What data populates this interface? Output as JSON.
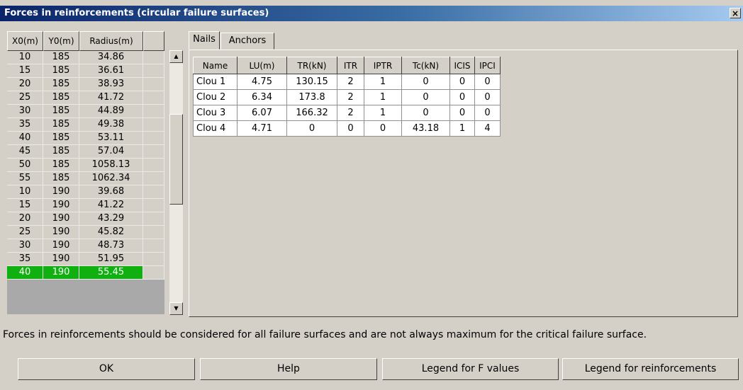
{
  "window": {
    "title": "Forces in reinforcements (circular failure surfaces)",
    "close_label": "×"
  },
  "surfaces": {
    "columns": [
      "X0(m)",
      "Y0(m)",
      "Radius(m)"
    ],
    "rows": [
      [
        "10",
        "185",
        "34.86"
      ],
      [
        "15",
        "185",
        "36.61"
      ],
      [
        "20",
        "185",
        "38.93"
      ],
      [
        "25",
        "185",
        "41.72"
      ],
      [
        "30",
        "185",
        "44.89"
      ],
      [
        "35",
        "185",
        "49.38"
      ],
      [
        "40",
        "185",
        "53.11"
      ],
      [
        "45",
        "185",
        "57.04"
      ],
      [
        "50",
        "185",
        "1058.13"
      ],
      [
        "55",
        "185",
        "1062.34"
      ],
      [
        "10",
        "190",
        "39.68"
      ],
      [
        "15",
        "190",
        "41.22"
      ],
      [
        "20",
        "190",
        "43.29"
      ],
      [
        "25",
        "190",
        "45.82"
      ],
      [
        "30",
        "190",
        "48.73"
      ],
      [
        "35",
        "190",
        "51.95"
      ],
      [
        "40",
        "190",
        "55.45"
      ]
    ],
    "selected_index": 16,
    "selected_color": "#10b010"
  },
  "tabs": [
    {
      "label": "Nails",
      "active": true
    },
    {
      "label": "Anchors",
      "active": false
    }
  ],
  "reinforcements": {
    "columns": [
      "Name",
      "LU(m)",
      "TR(kN)",
      "ITR",
      "IPTR",
      "Tc(kN)",
      "ICIS",
      "IPCI"
    ],
    "rows": [
      [
        "Clou 1",
        "4.75",
        "130.15",
        "2",
        "1",
        "0",
        "0",
        "0"
      ],
      [
        "Clou 2",
        "6.34",
        "173.8",
        "2",
        "1",
        "0",
        "0",
        "0"
      ],
      [
        "Clou 3",
        "6.07",
        "166.32",
        "2",
        "1",
        "0",
        "0",
        "0"
      ],
      [
        "Clou 4",
        "4.71",
        "0",
        "0",
        "0",
        "43.18",
        "1",
        "4"
      ]
    ]
  },
  "note": "Forces in reinforcements should be considered for all failure surfaces and are not always maximum for the critical failure surface.",
  "buttons": {
    "ok": "OK",
    "help": "Help",
    "legend_f": "Legend for F values",
    "legend_reinf": "Legend for reinforcements"
  },
  "icons": {
    "scroll_up": "scroll-up-arrow-icon",
    "scroll_down": "scroll-down-arrow-icon"
  }
}
